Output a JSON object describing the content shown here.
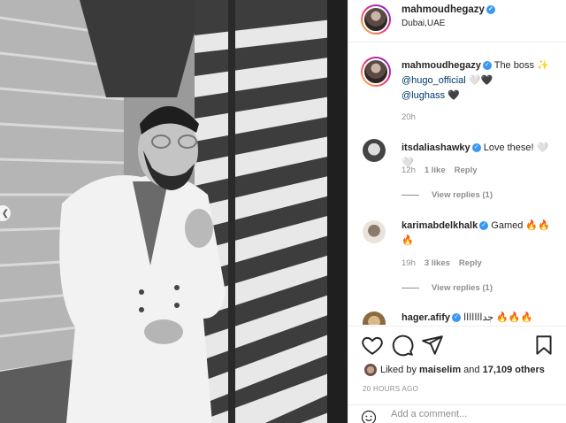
{
  "post": {
    "author": "mahmoudhegazy",
    "location": "Dubai,UAE",
    "caption": {
      "username": "mahmoudhegazy",
      "text": "The boss ✨",
      "mention1": "@hugo_official",
      "mention1_suffix": " 🤍🖤",
      "mention2": "@lughass",
      "mention2_suffix": " 🖤",
      "time": "20h"
    },
    "comments": [
      {
        "username": "itsdaliashawky",
        "text": "Love these! 🤍🤍",
        "time": "12h",
        "likes": "1 like",
        "reply": "Reply",
        "view_replies": "View replies (1)"
      },
      {
        "username": "karimabdelkhalk",
        "text": "Gamed 🔥🔥",
        "text2": "🔥",
        "time": "19h",
        "likes": "3 likes",
        "reply": "Reply",
        "view_replies": "View replies (1)"
      },
      {
        "username": "hager.afify",
        "text": "جدااااااا 🔥🔥🔥"
      }
    ],
    "likes": {
      "prefix": "Liked by ",
      "user": "maiselim",
      "middle": " and ",
      "count": "17,109 others"
    },
    "timestamp": "20 HOURS AGO",
    "add_comment_placeholder": "Add a comment..."
  },
  "icons": {
    "verified": "verified-badge-icon",
    "like": "heart-icon",
    "comment": "comment-icon",
    "share": "share-icon",
    "save": "bookmark-icon",
    "emoji": "smile-icon",
    "prev": "chevron-left-icon"
  }
}
